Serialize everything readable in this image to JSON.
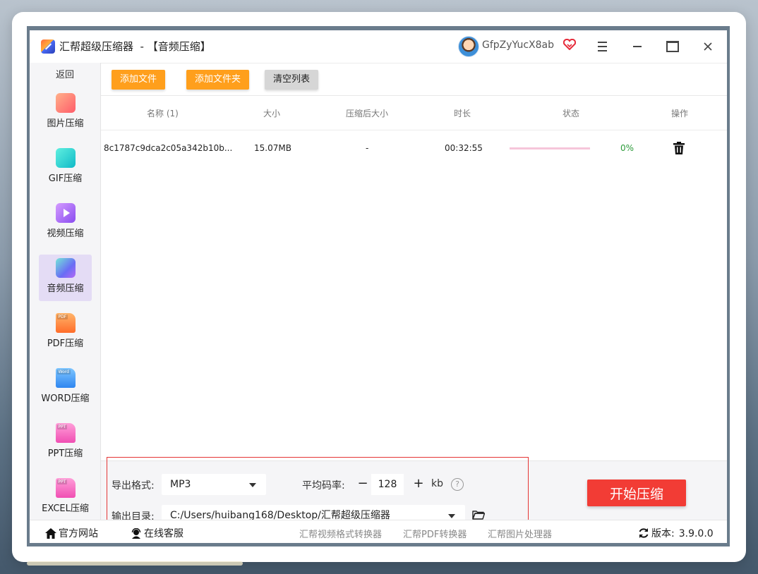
{
  "window": {
    "title": "汇帮超级压缩器  - 【音频压缩】",
    "username": "GfpZyYucX8ab"
  },
  "sidebar": {
    "back": "返回",
    "items": [
      {
        "label": "图片压缩",
        "icon": "image-icon"
      },
      {
        "label": "GIF压缩",
        "icon": "gif-icon"
      },
      {
        "label": "视频压缩",
        "icon": "video-icon"
      },
      {
        "label": "音频压缩",
        "icon": "audio-icon",
        "active": true
      },
      {
        "label": "PDF压缩",
        "icon": "pdf-icon",
        "tag": "PDF"
      },
      {
        "label": "WORD压缩",
        "icon": "word-icon",
        "tag": "Word"
      },
      {
        "label": "PPT压缩",
        "icon": "ppt-icon",
        "tag": "PPT"
      },
      {
        "label": "EXCEL压缩",
        "icon": "excel-icon",
        "tag": "PPT"
      }
    ]
  },
  "toolbar": {
    "add_file": "添加文件",
    "add_folder": "添加文件夹",
    "clear_list": "清空列表"
  },
  "table": {
    "headers": {
      "name": "名称 (1)",
      "size": "大小",
      "compressed_size": "压缩后大小",
      "duration": "时长",
      "status": "状态",
      "action": "操作"
    },
    "rows": [
      {
        "name": "8c1787c9dca2c05a342b10b...",
        "size": "15.07MB",
        "compressed_size": "-",
        "duration": "00:32:55",
        "progress": 0,
        "percent": "0%"
      }
    ]
  },
  "settings": {
    "format_label": "导出格式:",
    "format_value": "MP3",
    "bitrate_label": "平均码率:",
    "bitrate_value": "128",
    "bitrate_unit": "kb",
    "help": "?",
    "output_label": "输出目录:",
    "output_value": "C:/Users/huibang168/Desktop/汇帮超级压缩器",
    "start_button": "开始压缩"
  },
  "footer": {
    "website": "官方网站",
    "support": "在线客服",
    "tools": [
      "汇帮视频格式转换器",
      "汇帮PDF转换器",
      "汇帮图片处理器"
    ],
    "version_label": "版本:",
    "version": "3.9.0.0"
  },
  "colors": {
    "accent_orange": "#ff9f1c",
    "start_red": "#f23c35",
    "frame_red": "#e53535",
    "active_sidebar": "#e4dcf5",
    "progress_green": "#2c9b3a"
  }
}
